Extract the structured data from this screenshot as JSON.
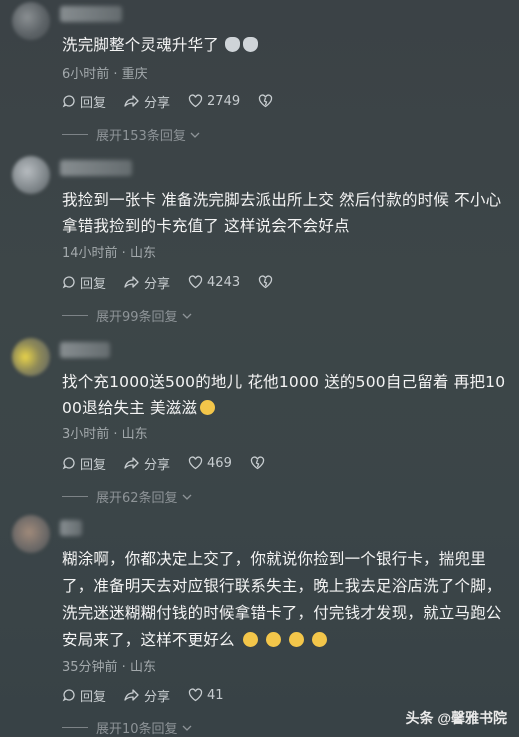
{
  "comments": [
    {
      "text": "洗完脚整个灵魂升华了",
      "emojis": [
        "cat-face-emoji",
        "cat-face-emoji"
      ],
      "time": "6小时前 · 重庆",
      "reply_label": "回复",
      "share_label": "分享",
      "likes": "2749",
      "expand_label": "展开153条回复"
    },
    {
      "text": "我捡到一张卡 准备洗完脚去派出所上交 然后付款的时候 不小心拿错我捡到的卡充值了 这样说会不会好点",
      "time": "14小时前 · 山东",
      "reply_label": "回复",
      "share_label": "分享",
      "likes": "4243",
      "expand_label": "展开99条回复"
    },
    {
      "text": "找个充1000送500的地儿 花他1000 送的500自己留着 再把1000退给失主 美滋滋",
      "emojis": [
        "grin-emoji"
      ],
      "time": "3小时前 · 山东",
      "reply_label": "回复",
      "share_label": "分享",
      "likes": "469",
      "expand_label": "展开62条回复"
    },
    {
      "text": "糊涂啊，你都决定上交了，你就说你捡到一个银行卡，揣兜里了，准备明天去对应银行联系失主，晚上我去足浴店洗了个脚，洗完迷迷糊糊付钱的时候拿错卡了，付完钱才发现，就立马跑公安局来了，这样不更好么",
      "emojis": [
        "smirk-emoji",
        "smirk-emoji",
        "smirk-emoji",
        "smirk-emoji"
      ],
      "time": "35分钟前 · 山东",
      "reply_label": "回复",
      "share_label": "分享",
      "likes": "41",
      "expand_label": "展开10条回复"
    }
  ],
  "watermark": "头条 @馨雅书院",
  "icons": {
    "reply": "reply-icon",
    "share": "share-icon",
    "like": "heart-icon",
    "dislike": "broken-heart-icon",
    "expand": "chevron-down-icon"
  }
}
